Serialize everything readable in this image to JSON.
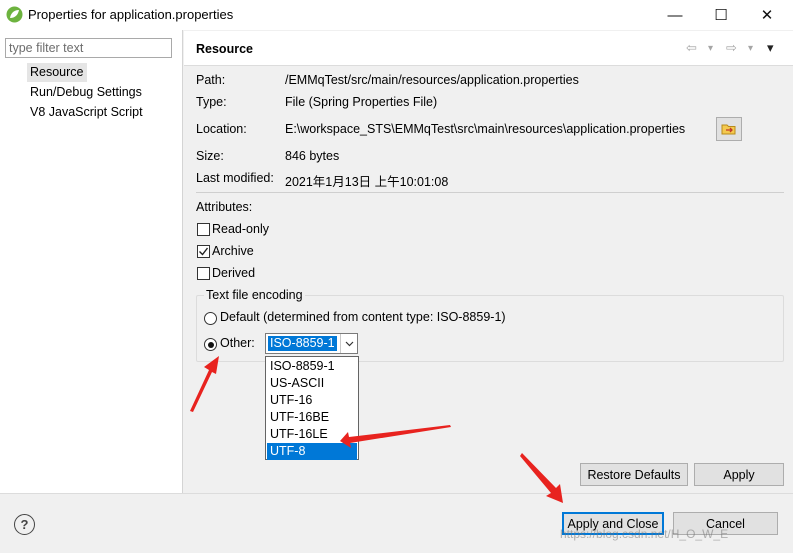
{
  "window": {
    "title": "Properties for application.properties",
    "minimize_glyph": "—",
    "maximize_glyph": "☐",
    "close_glyph": "✕"
  },
  "sidebar": {
    "filter_placeholder": "type filter text",
    "items": [
      {
        "label": "Resource",
        "selected": true
      },
      {
        "label": "Run/Debug Settings",
        "selected": false
      },
      {
        "label": "V8 JavaScript Script",
        "selected": false
      }
    ]
  },
  "page": {
    "title": "Resource",
    "nav": {
      "back_glyph": "⇦",
      "forward_glyph": "⇨",
      "menu_glyph": "▾"
    }
  },
  "info": {
    "path_label": "Path:",
    "path_value": "/EMMqTest/src/main/resources/application.properties",
    "type_label": "Type:",
    "type_value": "File  (Spring Properties File)",
    "location_label": "Location:",
    "location_value": "E:\\workspace_STS\\EMMqTest\\src\\main\\resources\\application.properties",
    "size_label": "Size:",
    "size_value": "846  bytes",
    "modified_label": "Last modified:",
    "modified_value": "2021年1月13日 上午10:01:08"
  },
  "attributes": {
    "heading": "Attributes:",
    "readonly": {
      "label": "Read-only",
      "checked": false
    },
    "archive": {
      "label": "Archive",
      "checked": true
    },
    "derived": {
      "label": "Derived",
      "checked": false
    }
  },
  "encoding": {
    "group_title": "Text file encoding",
    "default_label": "Default (determined from content type: ISO-8859-1)",
    "other_label": "Other:",
    "selected_option": "default",
    "current_value": "ISO-8859-1",
    "options": [
      "ISO-8859-1",
      "US-ASCII",
      "UTF-16",
      "UTF-16BE",
      "UTF-16LE",
      "UTF-8"
    ],
    "highlighted_option": "UTF-8"
  },
  "buttons": {
    "restore_defaults": "Restore Defaults",
    "apply": "Apply",
    "apply_and_close": "Apply and Close",
    "cancel": "Cancel",
    "help": "?"
  },
  "watermark": "https://blog.csdn.net/H_O_W_E",
  "colors": {
    "selection": "#0078d7",
    "annotation_arrow": "#e8231f",
    "spring_leaf": "#6db33f"
  }
}
